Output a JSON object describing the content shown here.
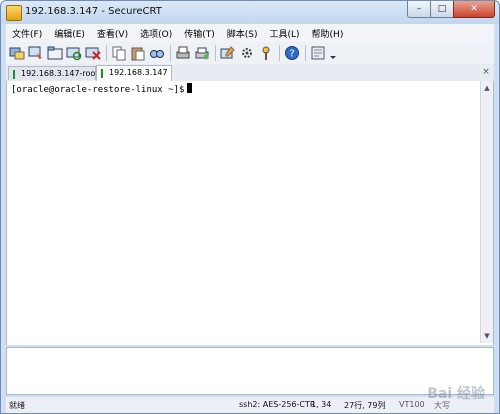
{
  "window": {
    "title": "192.168.3.147 - SecureCRT"
  },
  "window_controls": {
    "minimize": "–",
    "maximize": "□",
    "close": "✕"
  },
  "menu": [
    "文件(F)",
    "编辑(E)",
    "查看(V)",
    "选项(O)",
    "传输(T)",
    "脚本(S)",
    "工具(L)",
    "帮助(H)"
  ],
  "toolbar": {
    "icons": [
      "connect-icon",
      "quick-connect-icon",
      "connect-tab-icon",
      "reconnect-icon",
      "disconnect-icon",
      "copy-icon",
      "paste-icon",
      "find-icon",
      "print-icon",
      "print-setup-icon",
      "session-options-icon",
      "global-options-icon",
      "keymap-icon",
      "help-icon",
      "log-icon"
    ]
  },
  "tabs": [
    {
      "label": "192.168.3.147-root",
      "active": false
    },
    {
      "label": "192.168.3.147",
      "active": true
    }
  ],
  "tab_close": "×",
  "terminal": {
    "prompt": "[oracle@oracle-restore-linux ~]$"
  },
  "status": {
    "ready": "就绪",
    "cipher": "ssh2: AES-256-CTR",
    "position": "1,  34",
    "rows_cols": "27行, 79列",
    "terminal_type": "VT100",
    "caps": "大写"
  },
  "watermark": "Bai 经验",
  "colors": {
    "accent": "#1d8f2b",
    "close": "#c8442e",
    "frame": "#cfdef0"
  }
}
